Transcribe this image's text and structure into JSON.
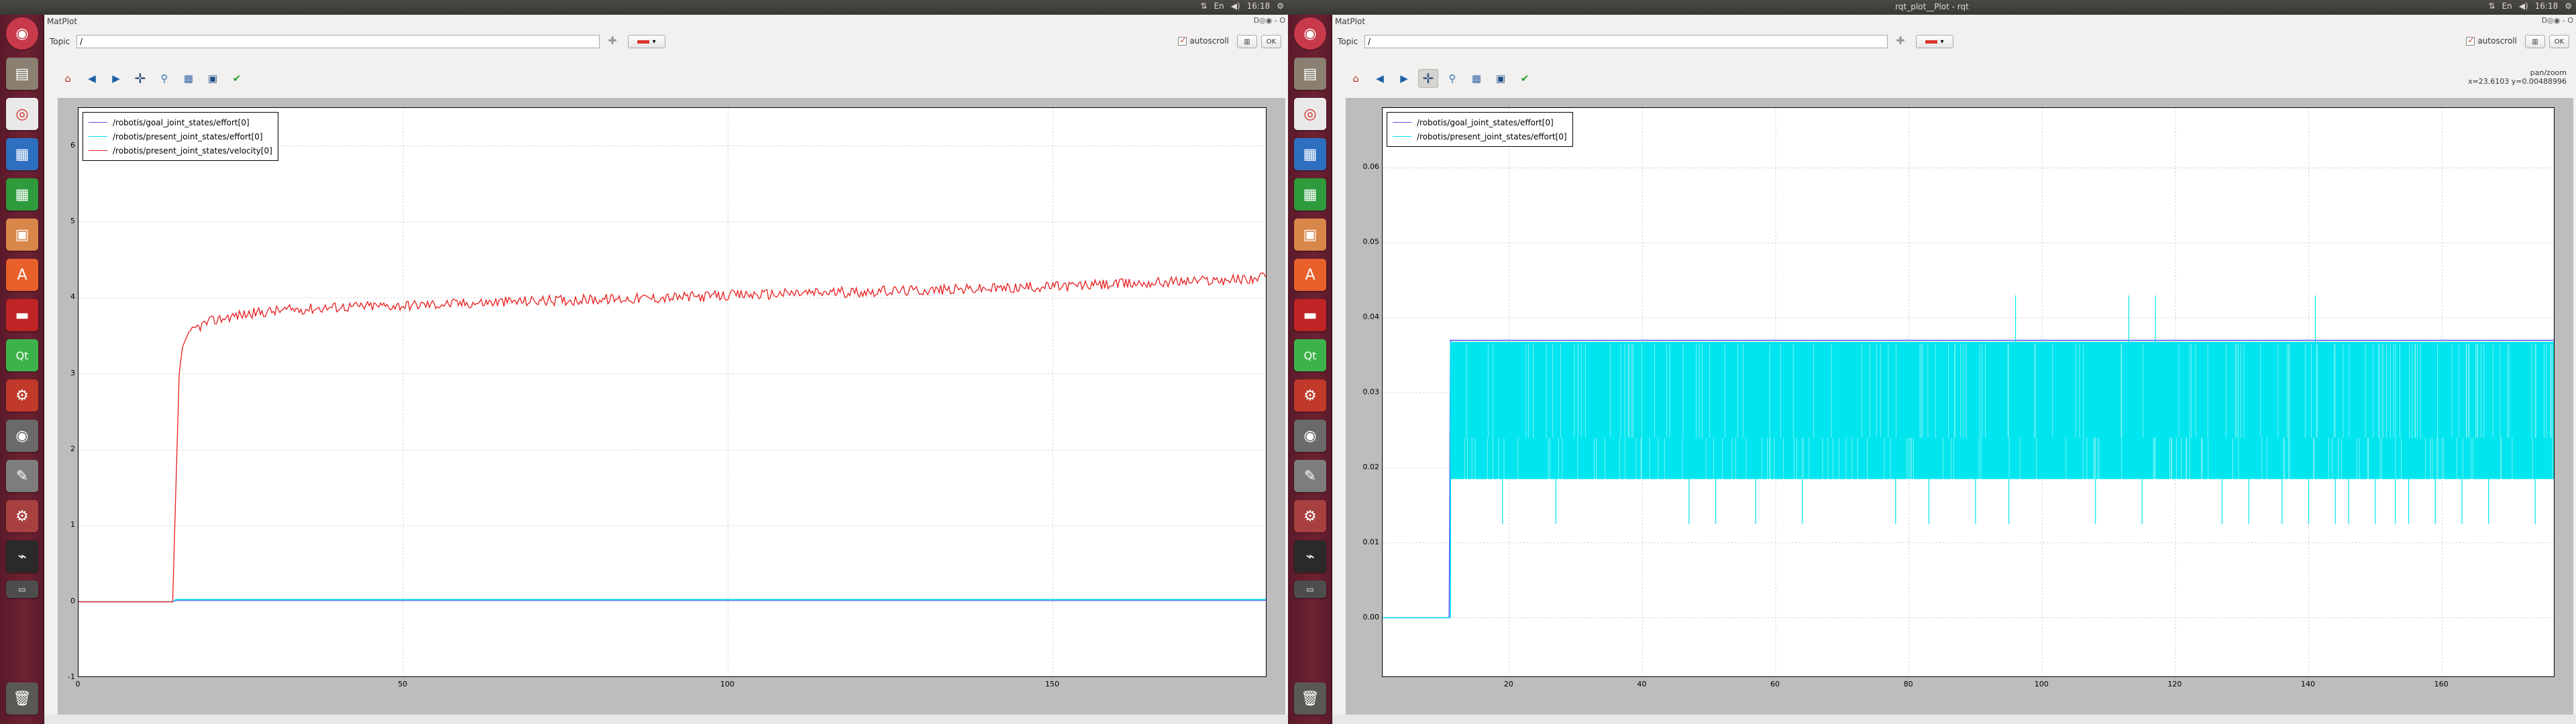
{
  "monitors": [
    {
      "id": "left",
      "topbar": {
        "title": "",
        "time": "16:18",
        "lang": "En"
      },
      "window": {
        "title": "MatPlot",
        "controls": "D◎◉ - O",
        "topic_label": "Topic",
        "topic_value": "/",
        "autoscroll_label": "autoscroll",
        "autoscroll_checked": true,
        "ok_label": "OK",
        "status_mode": "",
        "status_coords": ""
      },
      "chart_data": {
        "type": "line",
        "xlim": [
          0,
          183
        ],
        "ylim": [
          -1,
          6.5
        ],
        "xticks": [
          0,
          50,
          100,
          150
        ],
        "yticks": [
          -1,
          0,
          1,
          2,
          3,
          4,
          5,
          6
        ],
        "grid": true,
        "legend_position": "top-left",
        "series": [
          {
            "name": "/robotis/goal_joint_states/effort[0]",
            "color": "#5b5bff",
            "x": [
              0,
              14.5,
              15,
              183
            ],
            "y": [
              0,
              0,
              0.02,
              0.02
            ]
          },
          {
            "name": "/robotis/present_joint_states/effort[0]",
            "color": "#00e5ee",
            "x": [
              0,
              14.5,
              15,
              183
            ],
            "y": [
              0,
              0,
              0.03,
              0.03
            ]
          },
          {
            "name": "/robotis/present_joint_states/velocity[0]",
            "color": "#e81c1c",
            "x": [
              0,
              14.5,
              15,
              15.5,
              16,
              17,
              18,
              20,
              23,
              27,
              32,
              40,
              50,
              60,
              70,
              80,
              90,
              100,
              110,
              120,
              130,
              140,
              150,
              160,
              170,
              180,
              183
            ],
            "y": [
              0,
              0,
              1.5,
              3.0,
              3.35,
              3.5,
              3.6,
              3.68,
              3.75,
              3.8,
              3.84,
              3.88,
              3.9,
              3.93,
              3.96,
              3.98,
              4.0,
              4.03,
              4.06,
              4.08,
              4.1,
              4.12,
              4.15,
              4.18,
              4.22,
              4.25,
              4.27
            ]
          }
        ]
      }
    },
    {
      "id": "right",
      "topbar": {
        "title": "rqt_plot__Plot - rqt",
        "time": "16:18",
        "lang": "En"
      },
      "window": {
        "title": "MatPlot",
        "controls": "D◎◉ - O",
        "topic_label": "Topic",
        "topic_value": "/",
        "autoscroll_label": "autoscroll",
        "autoscroll_checked": true,
        "ok_label": "OK",
        "status_mode": "pan/zoom",
        "status_coords": "x=23.6103    y=0.00488996"
      },
      "chart_data": {
        "type": "line",
        "xlim": [
          1,
          177
        ],
        "ylim": [
          -0.008,
          0.068
        ],
        "xticks": [
          20,
          40,
          60,
          80,
          100,
          120,
          140,
          160
        ],
        "yticks": [
          0.0,
          0.01,
          0.02,
          0.03,
          0.04,
          0.05,
          0.06
        ],
        "grid": true,
        "legend_position": "top-left",
        "series": [
          {
            "name": "/robotis/goal_joint_states/effort[0]",
            "color": "#5b5bff",
            "x": [
              1,
              11,
              11.2,
              177
            ],
            "y": [
              0,
              0,
              0.037,
              0.037
            ]
          },
          {
            "name": "/robotis/present_joint_states/effort[0]",
            "color": "#00e5ee",
            "x": [
              1,
              11,
              11.2,
              177
            ],
            "y": [
              0,
              0,
              0.0185,
              0.0185
            ],
            "band": [
              0.0185,
              0.0368
            ],
            "spikes_up": [
              96,
              113,
              117,
              141
            ],
            "spikes_down": [
              19,
              27,
              47,
              51,
              57,
              64,
              78,
              83,
              90,
              95,
              108,
              115,
              127,
              131,
              136,
              140,
              144,
              146,
              150,
              153,
              155,
              159,
              163,
              167,
              174
            ]
          }
        ]
      }
    }
  ]
}
